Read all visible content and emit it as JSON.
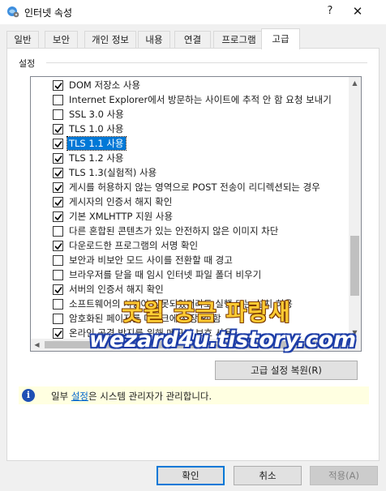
{
  "window": {
    "title": "인터넷 속성",
    "help_label": "?",
    "close_label": "✕"
  },
  "tabs": [
    {
      "label": "일반"
    },
    {
      "label": "보안"
    },
    {
      "label": "개인 정보"
    },
    {
      "label": "내용"
    },
    {
      "label": "연결"
    },
    {
      "label": "프로그램"
    },
    {
      "label": "고급",
      "active": true
    }
  ],
  "settings": {
    "group_label": "설정",
    "items": [
      {
        "label": "DOM 저장소 사용",
        "checked": true
      },
      {
        "label": "Internet Explorer에서 방문하는 사이트에 추적 안 함 요청 보내기",
        "checked": false
      },
      {
        "label": "SSL 3.0 사용",
        "checked": false
      },
      {
        "label": "TLS 1.0 사용",
        "checked": true
      },
      {
        "label": "TLS 1.1 사용",
        "checked": true,
        "selected": true
      },
      {
        "label": "TLS 1.2 사용",
        "checked": true
      },
      {
        "label": "TLS 1.3(실험적) 사용",
        "checked": true
      },
      {
        "label": "게시를 허용하지 않는 영역으로 POST 전송이 리디렉션되는 경우",
        "checked": true
      },
      {
        "label": "게시자의 인증서 해지 확인",
        "checked": true
      },
      {
        "label": "기본 XMLHTTP 지원 사용",
        "checked": true
      },
      {
        "label": "다른 혼합된 콘텐츠가 있는 안전하지 않은 이미지 차단",
        "checked": false
      },
      {
        "label": "다운로드한 프로그램의 서명 확인",
        "checked": true
      },
      {
        "label": "보안과 비보안 모드 사이를 전환할 때 경고",
        "checked": false
      },
      {
        "label": "브라우저를 닫을 때 임시 인터넷 파일 폴더 비우기",
        "checked": false
      },
      {
        "label": "서버의 인증서 해지 확인",
        "checked": true
      },
      {
        "label": "소프트웨어의 서명이 잘못되었더라도 실행 또는 설치 허용",
        "checked": false
      },
      {
        "label": "암호화된 페이지를 디스크에 저장 안 함",
        "checked": false
      },
      {
        "label": "온라인 공격 방지를 위해 메모리 보호 사용",
        "checked": true
      }
    ]
  },
  "restore_button_label": "고급 설정 복원(R)",
  "info": {
    "icon": "info-icon",
    "prefix": "일부 ",
    "link": "설정",
    "suffix": "은 시스템 관리자가 관리합니다."
  },
  "watermark": {
    "line1": "굿윌 궁금 파랑새",
    "line2": "wezard4u.tistory.com"
  },
  "buttons": {
    "ok": "확인",
    "cancel": "취소",
    "apply": "적용(A)"
  }
}
